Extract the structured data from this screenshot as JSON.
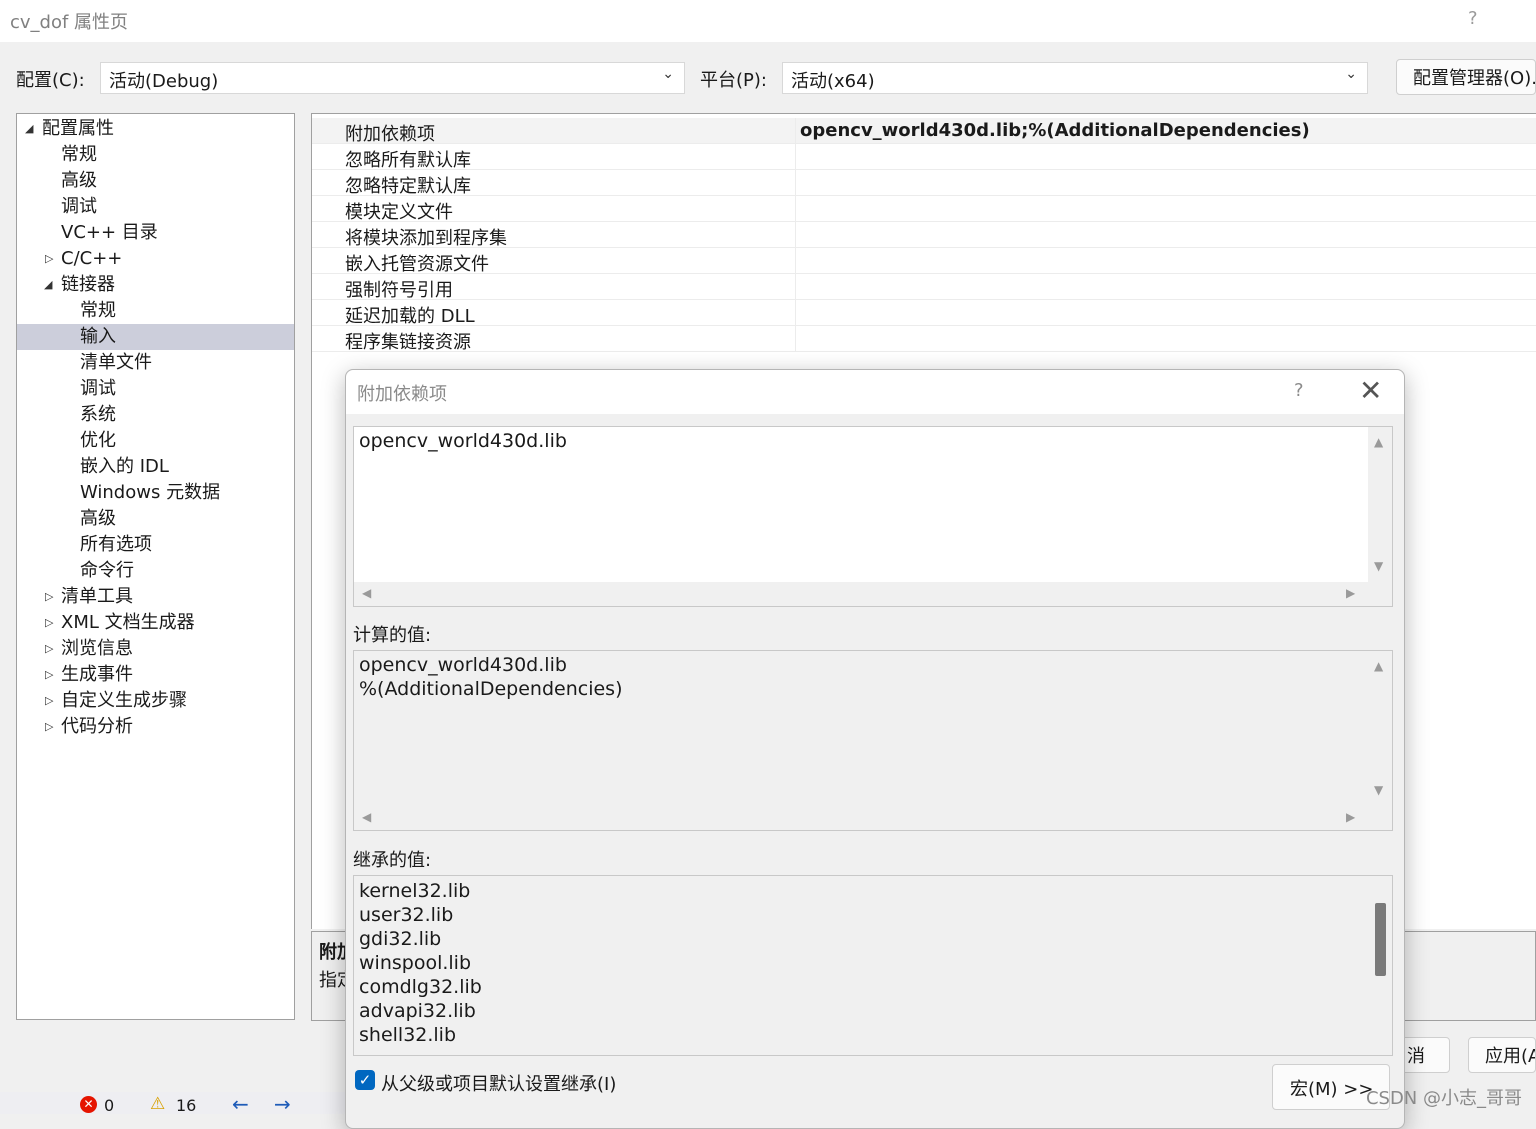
{
  "window": {
    "title": "cv_dof 属性页",
    "help": "?"
  },
  "config_row": {
    "config_label": "配置(C):",
    "config_value": "活动(Debug)",
    "platform_label": "平台(P):",
    "platform_value": "活动(x64)",
    "manager_button": "配置管理器(O)..."
  },
  "tree": {
    "items": [
      {
        "label": "配置属性"
      },
      {
        "label": "常规"
      },
      {
        "label": "高级"
      },
      {
        "label": "调试"
      },
      {
        "label": "VC++ 目录"
      },
      {
        "label": "C/C++"
      },
      {
        "label": "链接器"
      },
      {
        "label": "常规"
      },
      {
        "label": "输入"
      },
      {
        "label": "清单文件"
      },
      {
        "label": "调试"
      },
      {
        "label": "系统"
      },
      {
        "label": "优化"
      },
      {
        "label": "嵌入的 IDL"
      },
      {
        "label": "Windows 元数据"
      },
      {
        "label": "高级"
      },
      {
        "label": "所有选项"
      },
      {
        "label": "命令行"
      },
      {
        "label": "清单工具"
      },
      {
        "label": "XML 文档生成器"
      },
      {
        "label": "浏览信息"
      },
      {
        "label": "生成事件"
      },
      {
        "label": "自定义生成步骤"
      },
      {
        "label": "代码分析"
      }
    ]
  },
  "properties": [
    {
      "name": "附加依赖项",
      "value": "opencv_world430d.lib;%(AdditionalDependencies)"
    },
    {
      "name": "忽略所有默认库",
      "value": ""
    },
    {
      "name": "忽略特定默认库",
      "value": ""
    },
    {
      "name": "模块定义文件",
      "value": ""
    },
    {
      "name": "将模块添加到程序集",
      "value": ""
    },
    {
      "name": "嵌入托管资源文件",
      "value": ""
    },
    {
      "name": "强制符号引用",
      "value": ""
    },
    {
      "name": "延迟加载的 DLL",
      "value": ""
    },
    {
      "name": "程序集链接资源",
      "value": ""
    }
  ],
  "description": {
    "title": "附加",
    "text": "指定"
  },
  "main_buttons": {
    "cancel": "消",
    "apply": "应用(A"
  },
  "status_bar": {
    "errors": "0",
    "warnings": "16"
  },
  "dialog": {
    "title": "附加依赖项",
    "help": "?",
    "close": "✕",
    "edit_lines": [
      "opencv_world430d.lib"
    ],
    "computed_label": "计算的值:",
    "computed_lines": [
      "opencv_world430d.lib",
      "%(AdditionalDependencies)"
    ],
    "inherited_label": "继承的值:",
    "inherited_lines": [
      "kernel32.lib",
      "user32.lib",
      "gdi32.lib",
      "winspool.lib",
      "comdlg32.lib",
      "advapi32.lib",
      "shell32.lib"
    ],
    "inherit_checkbox_label": "从父级或项目默认设置继承(I)",
    "inherit_checked": true,
    "macro_button": "宏(M) >>"
  },
  "watermark": "CSDN @小志_哥哥",
  "colors": {
    "selected_tree": "#cccedb",
    "checkbox_accent": "#0067c0"
  }
}
